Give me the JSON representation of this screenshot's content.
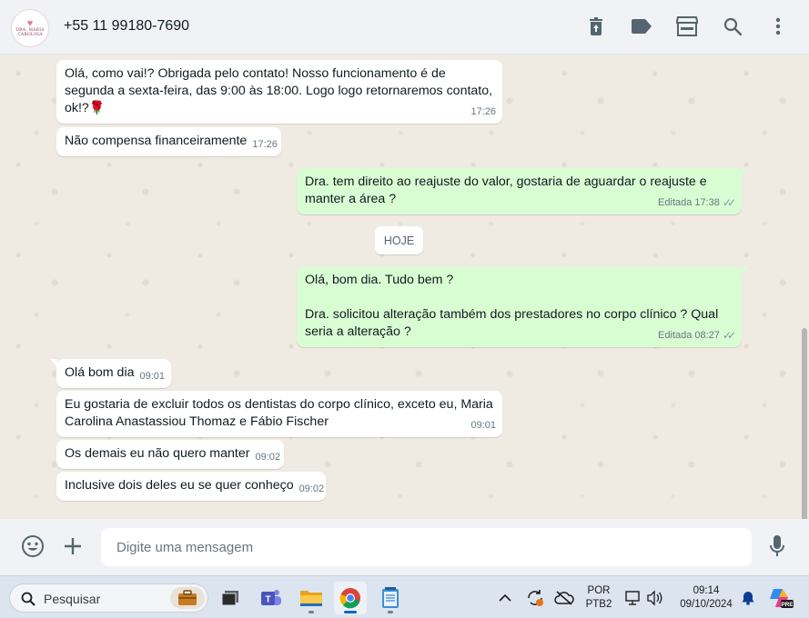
{
  "header": {
    "contact_name": "+55 11 99180-7690",
    "avatar_text_line1": "DRA. MARIA",
    "avatar_text_line2": "CAROLINA",
    "icons": [
      "delete-icon",
      "label-icon",
      "store-icon",
      "search-icon",
      "menu-icon"
    ]
  },
  "messages": [
    {
      "dir": "in",
      "text_lines": [
        "Olá, como vai!? Obrigada pelo contato! Nosso funcionamento é de",
        "segunda a sexta-feira, das 9:00 às 18:00. Logo logo retornaremos contato,",
        "ok!?🌹"
      ],
      "time": "17:26"
    },
    {
      "dir": "in",
      "text": "Não compensa financeiramente",
      "time": "17:26"
    },
    {
      "dir": "out",
      "text_lines": [
        "Dra. tem direito ao reajuste do valor, gostaria de aguardar o reajuste e",
        "manter a área ?"
      ],
      "edited": "Editada",
      "time": "17:38"
    },
    {
      "dir": "out",
      "text_lines": [
        "Olá, bom dia. Tudo bem ?",
        "",
        "Dra. solicitou alteração também dos prestadores no corpo clínico ? Qual",
        "seria a alteração ?"
      ],
      "edited": "Editada",
      "time": "08:27"
    },
    {
      "dir": "in",
      "text": "Olá bom dia",
      "time": "09:01"
    },
    {
      "dir": "in",
      "text_lines": [
        "Eu gostaria de excluir todos os dentistas do corpo clínico, exceto eu, Maria",
        "Carolina Anastassiou Thomaz e Fábio Fischer"
      ],
      "time": "09:01"
    },
    {
      "dir": "in",
      "text": "Os demais eu não quero manter",
      "time": "09:02"
    },
    {
      "dir": "in",
      "text": "Inclusive dois deles eu se quer conheço",
      "time": "09:02"
    }
  ],
  "date_divider": "HOJE",
  "composer": {
    "placeholder": "Digite uma mensagem",
    "icons": [
      "emoji-icon",
      "plus-icon",
      "microphone-icon"
    ]
  },
  "taskbar": {
    "search_label": "Pesquisar",
    "apps": [
      "task-view",
      "teams",
      "file-explorer",
      "chrome",
      "notepad"
    ],
    "language_line1": "POR",
    "language_line2": "PTB2",
    "time": "09:14",
    "date": "09/10/2024"
  },
  "colors": {
    "incoming_bubble": "#ffffff",
    "outgoing_bubble": "#d9fdd3",
    "chat_background": "#efeae2",
    "header_background": "#f0f2f5",
    "taskbar_background": "#dce4ef"
  }
}
